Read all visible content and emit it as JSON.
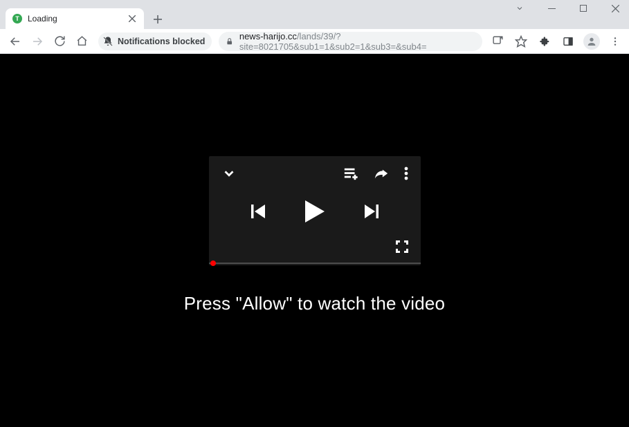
{
  "window": {
    "tab_title": "Loading"
  },
  "toolbar": {
    "notifications_label": "Notifications blocked",
    "url_domain": "news-harijo.cc",
    "url_path": "/lands/39/?site=8021705&sub1=1&sub2=1&sub3=&sub4="
  },
  "page": {
    "prompt": "Press \"Allow\" to watch the video"
  },
  "icons": {
    "chevron_down": "chevron-down-icon",
    "playlist_add": "playlist-add-icon",
    "share": "share-icon",
    "more": "more-vert-icon",
    "prev": "previous-track-icon",
    "play": "play-icon",
    "next": "next-track-icon",
    "fullscreen": "fullscreen-icon"
  }
}
